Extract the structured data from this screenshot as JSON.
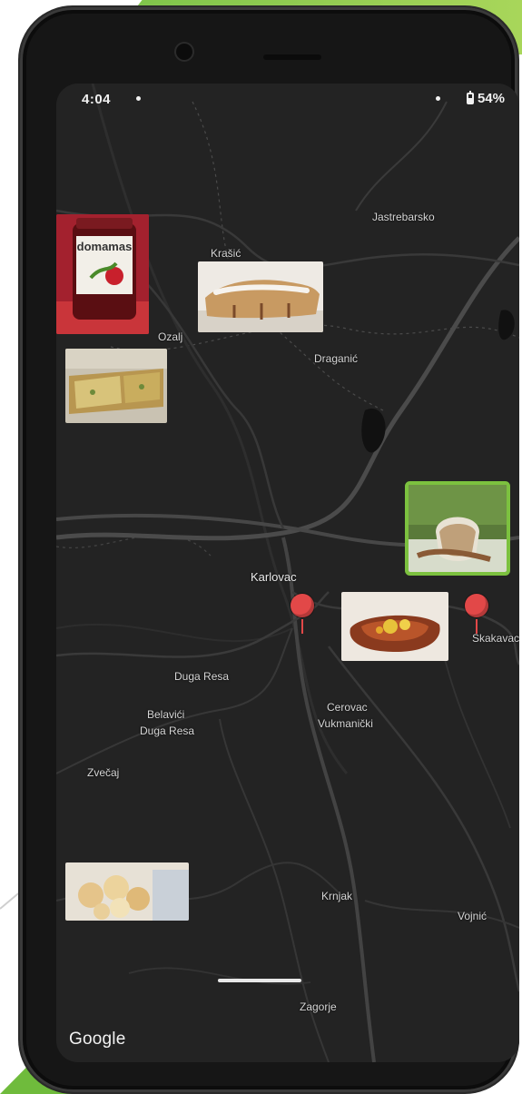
{
  "status_bar": {
    "time": "4:04",
    "battery": "54%"
  },
  "map": {
    "attribution": "Google",
    "places": {
      "jastrebarsko": "Jastrebarsko",
      "krasic": "Krašić",
      "ozalj": "Ozalj",
      "draganic": "Draganić",
      "karlovac": "Karlovac",
      "skakavac": "Skakavac",
      "duga_resa": "Duga Resa",
      "belavici": "Belavići",
      "duga_resa_2": "Duga Resa",
      "cerovac": "Cerovac",
      "vukmanicki": "Vukmanički",
      "zvecaj": "Zvečaj",
      "krnjak": "Krnjak",
      "vojnic": "Vojnić",
      "zagorje": "Zagorje"
    },
    "photos": {
      "jam_label": "domamas"
    }
  },
  "colors": {
    "map_background": "#232323",
    "road": "#3c3c3c",
    "pin": "#e24848",
    "selected_border": "#7cc13f"
  }
}
